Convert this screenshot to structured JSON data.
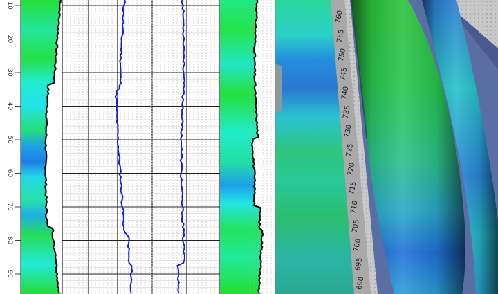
{
  "log_panel": {
    "depth_ticks": [
      "10",
      "20",
      "30",
      "40",
      "50",
      "60",
      "70",
      "80",
      "90"
    ],
    "tracks": [
      "image-track",
      "curve-grid-track",
      "curve-grid-track",
      "image-track"
    ]
  },
  "view_3d": {
    "depth_scale_labels": [
      "690",
      "695",
      "700",
      "705",
      "710",
      "715",
      "720",
      "725",
      "730",
      "735",
      "740",
      "745",
      "750",
      "755",
      "760"
    ]
  },
  "colors": {
    "curve": "#1a1adc",
    "profile": "#111111",
    "grid_major": "#222222",
    "grid_minor": "#b8b8b8",
    "green": "#22dd33",
    "cyan": "#22eedd",
    "blue": "#1e8be6",
    "background_3d": "#5a6ea4"
  }
}
